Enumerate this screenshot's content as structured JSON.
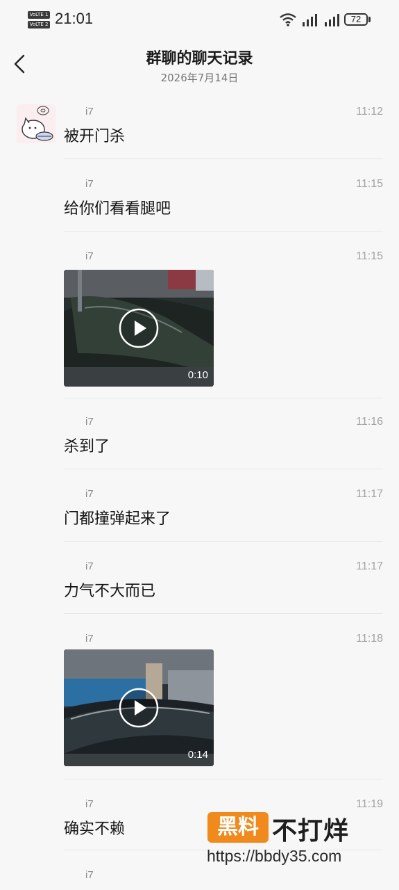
{
  "status_bar": {
    "volte_1": "VoLTE 1",
    "volte_2": "VoLTE 2",
    "clock": "21:01",
    "battery": "72"
  },
  "header": {
    "back_icon": "chevron-left-icon",
    "title": "群聊的聊天记录",
    "date": "2026年7月14日"
  },
  "messages": [
    {
      "sender": "i7",
      "time": "11:12",
      "type": "text",
      "text": "被开门杀"
    },
    {
      "sender": "i7",
      "time": "11:15",
      "type": "text",
      "text": "给你们看看腿吧"
    },
    {
      "sender": "i7",
      "time": "11:15",
      "type": "video",
      "duration": "0:10"
    },
    {
      "sender": "i7",
      "time": "11:16",
      "type": "text",
      "text": "杀到了"
    },
    {
      "sender": "i7",
      "time": "11:17",
      "type": "text",
      "text": "门都撞弹起来了"
    },
    {
      "sender": "i7",
      "time": "11:17",
      "type": "text",
      "text": "力气不大而已"
    },
    {
      "sender": "i7",
      "time": "11:18",
      "type": "video",
      "duration": "0:14"
    },
    {
      "sender": "i7",
      "time": "11:19",
      "type": "text",
      "text": "确实不赖"
    },
    {
      "sender": "i7",
      "time": "",
      "type": "text",
      "text": ""
    }
  ],
  "watermark": {
    "badge": "黑料",
    "name": "不打烊",
    "url": "https://bbdy35.com"
  },
  "colors": {
    "background": "#f7f7f7",
    "watermark_orange": "#f08a1c"
  }
}
